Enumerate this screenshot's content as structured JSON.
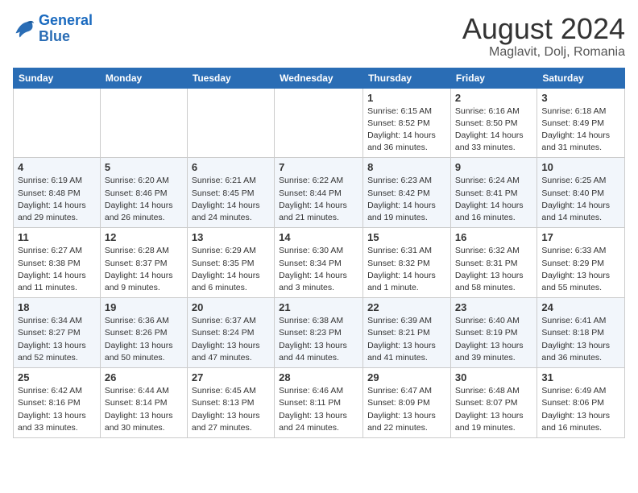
{
  "logo": {
    "line1": "General",
    "line2": "Blue"
  },
  "title": "August 2024",
  "location": "Maglavit, Dolj, Romania",
  "weekdays": [
    "Sunday",
    "Monday",
    "Tuesday",
    "Wednesday",
    "Thursday",
    "Friday",
    "Saturday"
  ],
  "weeks": [
    [
      {
        "day": "",
        "info": ""
      },
      {
        "day": "",
        "info": ""
      },
      {
        "day": "",
        "info": ""
      },
      {
        "day": "",
        "info": ""
      },
      {
        "day": "1",
        "info": "Sunrise: 6:15 AM\nSunset: 8:52 PM\nDaylight: 14 hours\nand 36 minutes."
      },
      {
        "day": "2",
        "info": "Sunrise: 6:16 AM\nSunset: 8:50 PM\nDaylight: 14 hours\nand 33 minutes."
      },
      {
        "day": "3",
        "info": "Sunrise: 6:18 AM\nSunset: 8:49 PM\nDaylight: 14 hours\nand 31 minutes."
      }
    ],
    [
      {
        "day": "4",
        "info": "Sunrise: 6:19 AM\nSunset: 8:48 PM\nDaylight: 14 hours\nand 29 minutes."
      },
      {
        "day": "5",
        "info": "Sunrise: 6:20 AM\nSunset: 8:46 PM\nDaylight: 14 hours\nand 26 minutes."
      },
      {
        "day": "6",
        "info": "Sunrise: 6:21 AM\nSunset: 8:45 PM\nDaylight: 14 hours\nand 24 minutes."
      },
      {
        "day": "7",
        "info": "Sunrise: 6:22 AM\nSunset: 8:44 PM\nDaylight: 14 hours\nand 21 minutes."
      },
      {
        "day": "8",
        "info": "Sunrise: 6:23 AM\nSunset: 8:42 PM\nDaylight: 14 hours\nand 19 minutes."
      },
      {
        "day": "9",
        "info": "Sunrise: 6:24 AM\nSunset: 8:41 PM\nDaylight: 14 hours\nand 16 minutes."
      },
      {
        "day": "10",
        "info": "Sunrise: 6:25 AM\nSunset: 8:40 PM\nDaylight: 14 hours\nand 14 minutes."
      }
    ],
    [
      {
        "day": "11",
        "info": "Sunrise: 6:27 AM\nSunset: 8:38 PM\nDaylight: 14 hours\nand 11 minutes."
      },
      {
        "day": "12",
        "info": "Sunrise: 6:28 AM\nSunset: 8:37 PM\nDaylight: 14 hours\nand 9 minutes."
      },
      {
        "day": "13",
        "info": "Sunrise: 6:29 AM\nSunset: 8:35 PM\nDaylight: 14 hours\nand 6 minutes."
      },
      {
        "day": "14",
        "info": "Sunrise: 6:30 AM\nSunset: 8:34 PM\nDaylight: 14 hours\nand 3 minutes."
      },
      {
        "day": "15",
        "info": "Sunrise: 6:31 AM\nSunset: 8:32 PM\nDaylight: 14 hours\nand 1 minute."
      },
      {
        "day": "16",
        "info": "Sunrise: 6:32 AM\nSunset: 8:31 PM\nDaylight: 13 hours\nand 58 minutes."
      },
      {
        "day": "17",
        "info": "Sunrise: 6:33 AM\nSunset: 8:29 PM\nDaylight: 13 hours\nand 55 minutes."
      }
    ],
    [
      {
        "day": "18",
        "info": "Sunrise: 6:34 AM\nSunset: 8:27 PM\nDaylight: 13 hours\nand 52 minutes."
      },
      {
        "day": "19",
        "info": "Sunrise: 6:36 AM\nSunset: 8:26 PM\nDaylight: 13 hours\nand 50 minutes."
      },
      {
        "day": "20",
        "info": "Sunrise: 6:37 AM\nSunset: 8:24 PM\nDaylight: 13 hours\nand 47 minutes."
      },
      {
        "day": "21",
        "info": "Sunrise: 6:38 AM\nSunset: 8:23 PM\nDaylight: 13 hours\nand 44 minutes."
      },
      {
        "day": "22",
        "info": "Sunrise: 6:39 AM\nSunset: 8:21 PM\nDaylight: 13 hours\nand 41 minutes."
      },
      {
        "day": "23",
        "info": "Sunrise: 6:40 AM\nSunset: 8:19 PM\nDaylight: 13 hours\nand 39 minutes."
      },
      {
        "day": "24",
        "info": "Sunrise: 6:41 AM\nSunset: 8:18 PM\nDaylight: 13 hours\nand 36 minutes."
      }
    ],
    [
      {
        "day": "25",
        "info": "Sunrise: 6:42 AM\nSunset: 8:16 PM\nDaylight: 13 hours\nand 33 minutes."
      },
      {
        "day": "26",
        "info": "Sunrise: 6:44 AM\nSunset: 8:14 PM\nDaylight: 13 hours\nand 30 minutes."
      },
      {
        "day": "27",
        "info": "Sunrise: 6:45 AM\nSunset: 8:13 PM\nDaylight: 13 hours\nand 27 minutes."
      },
      {
        "day": "28",
        "info": "Sunrise: 6:46 AM\nSunset: 8:11 PM\nDaylight: 13 hours\nand 24 minutes."
      },
      {
        "day": "29",
        "info": "Sunrise: 6:47 AM\nSunset: 8:09 PM\nDaylight: 13 hours\nand 22 minutes."
      },
      {
        "day": "30",
        "info": "Sunrise: 6:48 AM\nSunset: 8:07 PM\nDaylight: 13 hours\nand 19 minutes."
      },
      {
        "day": "31",
        "info": "Sunrise: 6:49 AM\nSunset: 8:06 PM\nDaylight: 13 hours\nand 16 minutes."
      }
    ]
  ]
}
